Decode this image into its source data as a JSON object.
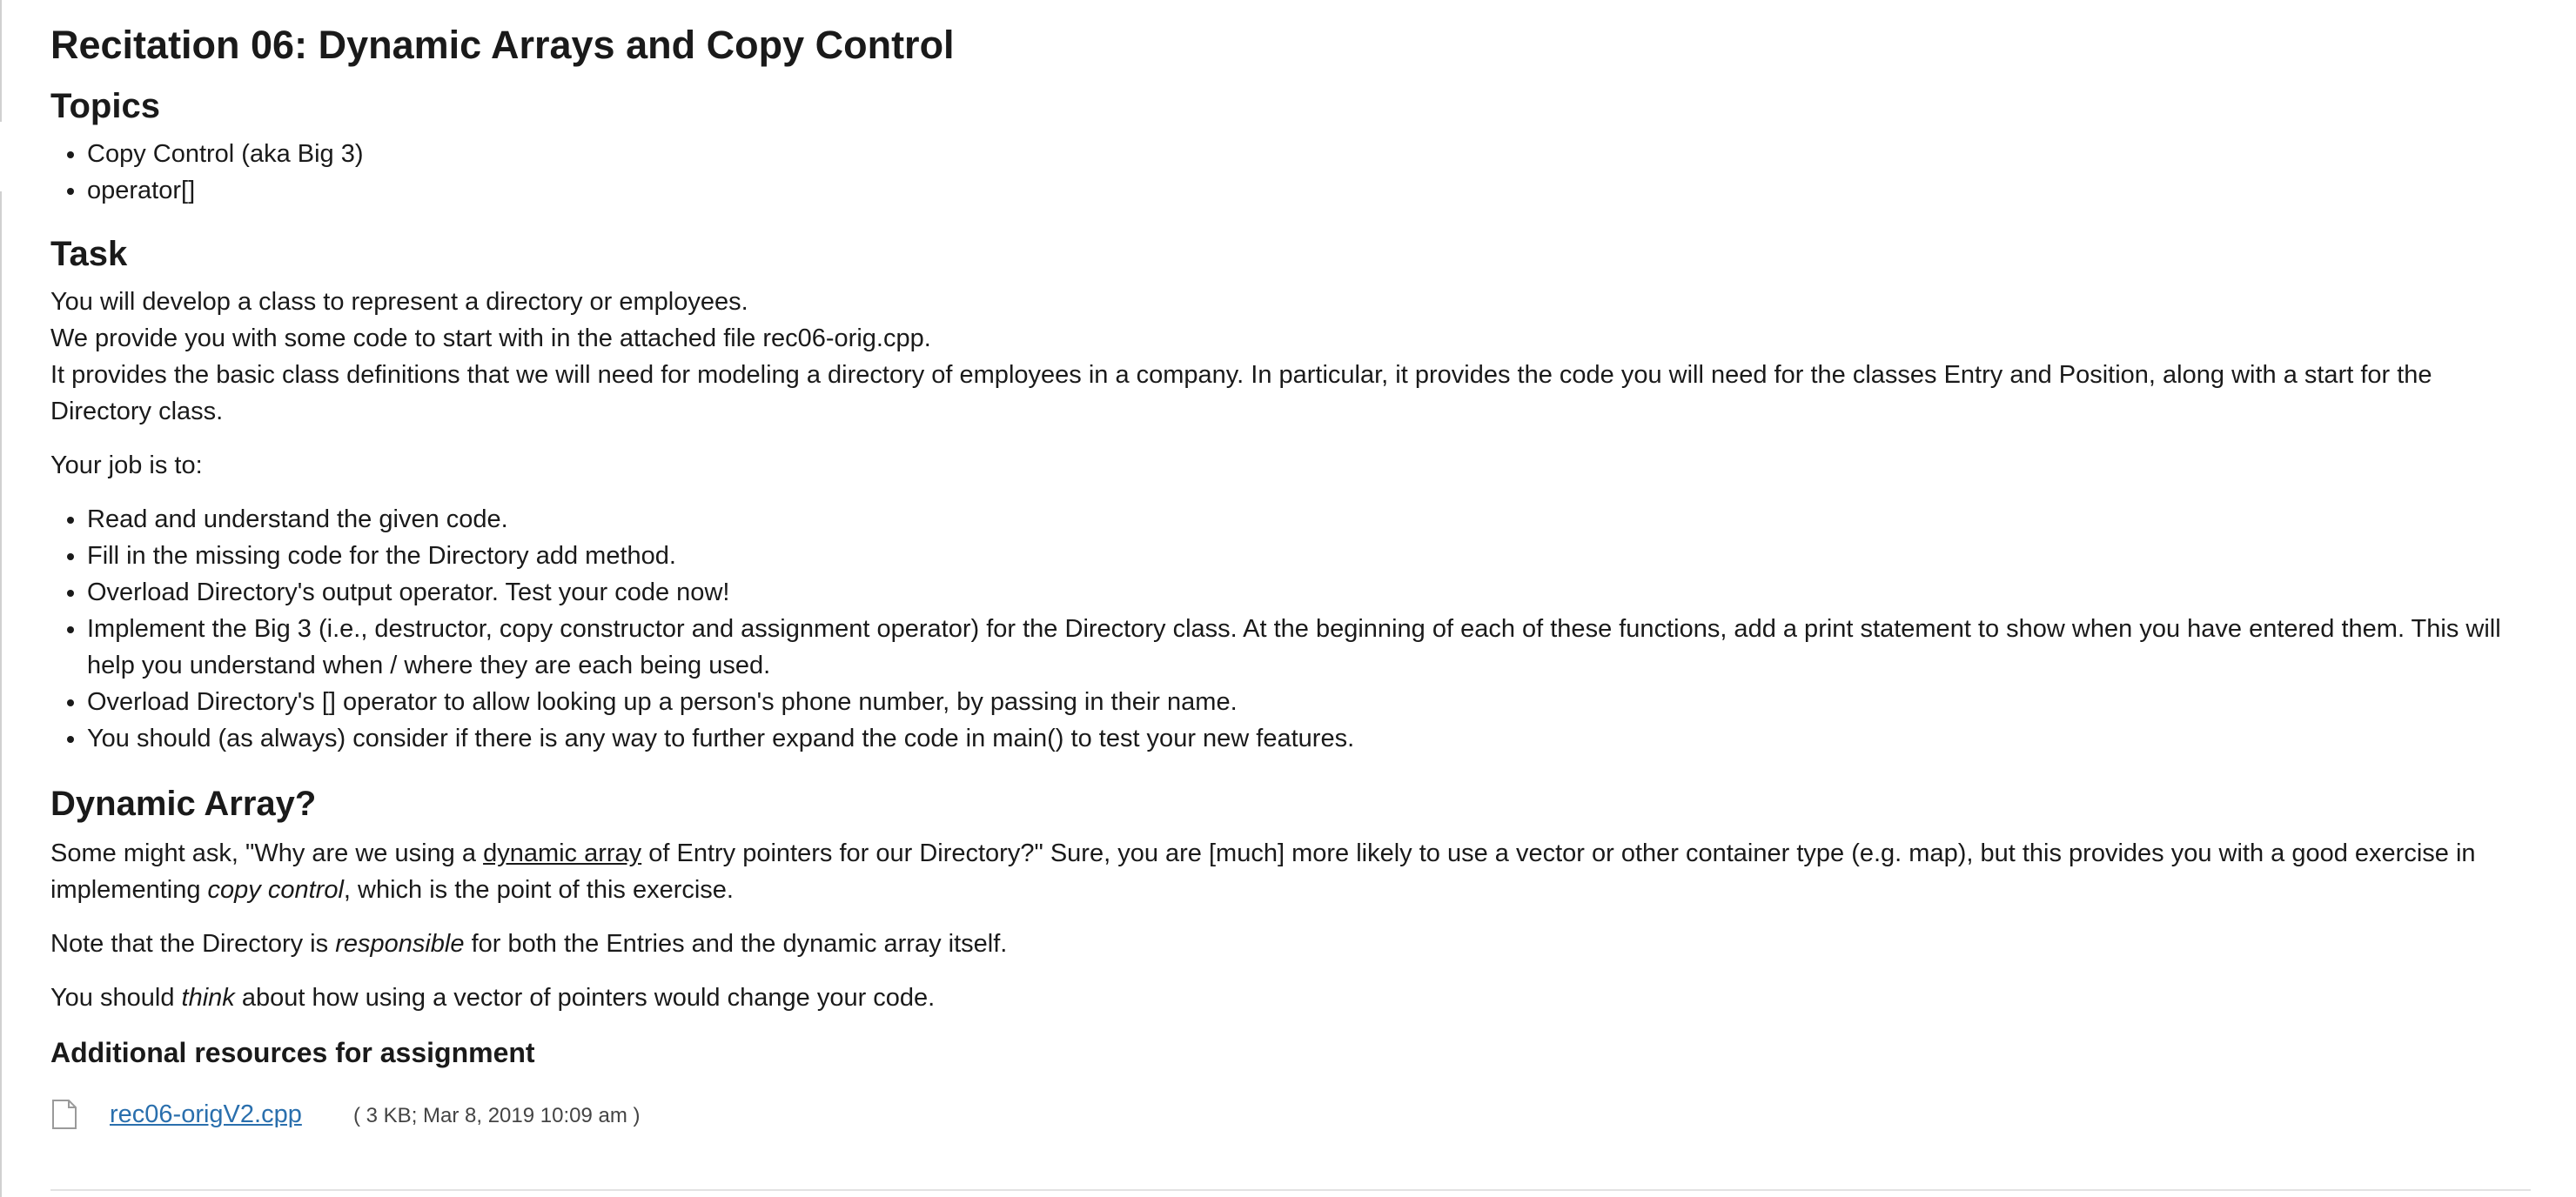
{
  "page": {
    "title": "Recitation 06: Dynamic Arrays and Copy Control"
  },
  "topics": {
    "heading": "Topics",
    "items": [
      "Copy Control (aka Big 3)",
      "operator[]"
    ]
  },
  "task": {
    "heading": "Task",
    "intro_lines": [
      "You will develop a class to represent a directory or employees.",
      "We provide you with some code to start with in the attached file rec06-orig.cpp.",
      "It provides the basic class definitions that we will need for modeling a directory of employees in a company. In particular, it provides the code you will need for the classes Entry and Position, along with a start for the Directory class."
    ],
    "job_intro": "Your job is to:",
    "jobs": [
      "Read and understand the given code.",
      "Fill in the missing code for the Directory add method.",
      "Overload Directory's output operator. Test your code now!",
      "Implement the Big 3 (i.e., destructor, copy constructor and assignment operator) for the Directory class. At the beginning of each of these functions, add a print statement to show when you have entered them. This will help you understand when / where they are each being used.",
      "Overload Directory's [] operator to allow looking up a person's phone number, by passing in their name.",
      "You should (as always) consider if there is any way to further expand the code in main() to test your new features."
    ]
  },
  "dynamic_array": {
    "heading": "Dynamic Array?",
    "p1": {
      "before_link": "Some might ask, \"Why are we using a ",
      "link": "dynamic array",
      "after_link": " of Entry pointers for our Directory?\" Sure, you are [much] more likely to use a vector or other container type (e.g. map), but this provides you with a good exercise in implementing ",
      "emphasis": "copy control",
      "end": ", which is the point of this exercise."
    },
    "p2": {
      "before": "Note that the Directory is ",
      "emphasis": "responsible",
      "after": " for both the Entries and the dynamic array itself."
    },
    "p3": {
      "before": "You should ",
      "emphasis": "think",
      "after": " about how using a vector of pointers would change your code."
    }
  },
  "resources": {
    "heading": "Additional resources for assignment",
    "file": {
      "icon": "file-icon",
      "name": "rec06-origV2.cpp",
      "meta": "( 3 KB; Mar 8, 2019 10:09 am )"
    }
  },
  "colors": {
    "text": "#1a1a1a",
    "link": "#2a6fad",
    "meta": "#444444",
    "rule": "#e2e2e2"
  }
}
